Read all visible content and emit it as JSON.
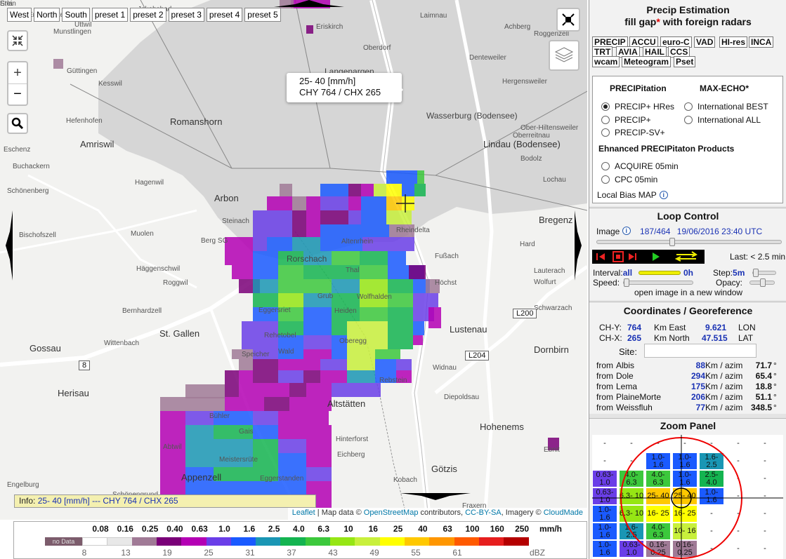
{
  "presets": [
    "West",
    "North",
    "South",
    "preset 1",
    "preset 2",
    "preset 3",
    "preset 4",
    "preset 5"
  ],
  "map": {
    "zoom_in": "+",
    "zoom_out": "−",
    "tooltip_line1": "25- 40 [mm/h]",
    "tooltip_line2": "CHY 764 / CHX 265",
    "info_label": "Info:",
    "info_value": "25- 40 [mm/h] --- CHY 764 / CHX 265",
    "attribution": {
      "leaflet": "Leaflet",
      "text1": " | Map data © ",
      "osm": "OpenStreetMap",
      "text2": " contributors, ",
      "license": "CC-BY-SA",
      "text3": ", Imagery © ",
      "cloudmade": "CloudMade"
    },
    "places": [
      {
        "name": "Romanshorn",
        "cls": "city"
      },
      {
        "name": "Amriswil",
        "cls": "city"
      },
      {
        "name": "Arbon",
        "cls": "city"
      },
      {
        "name": "St. Gallen",
        "cls": "city"
      },
      {
        "name": "Gossau",
        "cls": "city"
      },
      {
        "name": "Herisau",
        "cls": "city"
      },
      {
        "name": "Appenzell",
        "cls": "city"
      },
      {
        "name": "Altstätten",
        "cls": "city"
      },
      {
        "name": "Lustenau",
        "cls": "city"
      },
      {
        "name": "Dornbirn",
        "cls": "city"
      },
      {
        "name": "Hohenems",
        "cls": "city"
      },
      {
        "name": "Götzis",
        "cls": "city"
      },
      {
        "name": "Lindau (Bodensee)",
        "cls": "city"
      },
      {
        "name": "Bregenz",
        "cls": "city"
      },
      {
        "name": "Langenargen",
        "cls": "town"
      },
      {
        "name": "Wasserburg (Bodensee)",
        "cls": "town"
      },
      {
        "name": "Rorschach",
        "cls": "town"
      },
      {
        "name": "Berg SG",
        "cls": "place"
      },
      {
        "name": "Steinach",
        "cls": "place"
      },
      {
        "name": "Eriskirch",
        "cls": "place"
      },
      {
        "name": "Oberdorf",
        "cls": "place"
      },
      {
        "name": "Laimnau",
        "cls": "place"
      },
      {
        "name": "Achberg",
        "cls": "place"
      },
      {
        "name": "Roggenzell",
        "cls": "place"
      },
      {
        "name": "Denteweiler",
        "cls": "place"
      },
      {
        "name": "Hergensweiler",
        "cls": "place"
      },
      {
        "name": "Ober-Hiltensweiler",
        "cls": "place"
      },
      {
        "name": "Oberreitnau",
        "cls": "place"
      },
      {
        "name": "Bodolz",
        "cls": "place"
      },
      {
        "name": "Lochau",
        "cls": "place"
      },
      {
        "name": "Rheindelta",
        "cls": "place"
      },
      {
        "name": "Höchst",
        "cls": "place"
      },
      {
        "name": "Fußach",
        "cls": "place"
      },
      {
        "name": "Hard",
        "cls": "place"
      },
      {
        "name": "Lauterach",
        "cls": "place"
      },
      {
        "name": "Wolfurt",
        "cls": "place"
      },
      {
        "name": "Schwarzach",
        "cls": "place"
      },
      {
        "name": "Altenrhein",
        "cls": "place"
      },
      {
        "name": "Thal",
        "cls": "place"
      },
      {
        "name": "Heiden",
        "cls": "place"
      },
      {
        "name": "Grub",
        "cls": "place"
      },
      {
        "name": "Wolfhalden",
        "cls": "place"
      },
      {
        "name": "Rehetobel",
        "cls": "place"
      },
      {
        "name": "Eggersriet",
        "cls": "place"
      },
      {
        "name": "Wald",
        "cls": "place"
      },
      {
        "name": "Oberegg",
        "cls": "place"
      },
      {
        "name": "Rebstein",
        "cls": "place"
      },
      {
        "name": "Widnau",
        "cls": "place"
      },
      {
        "name": "Diepoldsau",
        "cls": "place"
      },
      {
        "name": "Kobach",
        "cls": "place"
      },
      {
        "name": "Hinterforst",
        "cls": "place"
      },
      {
        "name": "Eichberg",
        "cls": "place"
      },
      {
        "name": "Gais",
        "cls": "place"
      },
      {
        "name": "Bühler",
        "cls": "place"
      },
      {
        "name": "Meistersrüte",
        "cls": "place"
      },
      {
        "name": "Eggerstanden",
        "cls": "place"
      },
      {
        "name": "Fraxern",
        "cls": "place"
      },
      {
        "name": "Ebnit",
        "cls": "place"
      },
      {
        "name": "Speicher",
        "cls": "place"
      },
      {
        "name": "Bischofszell",
        "cls": "place"
      },
      {
        "name": "Güttingen",
        "cls": "place"
      },
      {
        "name": "Kesswil",
        "cls": "place"
      },
      {
        "name": "Hefenhofen",
        "cls": "place"
      },
      {
        "name": "Schönenberg",
        "cls": "place"
      },
      {
        "name": "Buchackern",
        "cls": "place"
      },
      {
        "name": "Hagenwil",
        "cls": "place"
      },
      {
        "name": "Muolen",
        "cls": "place"
      },
      {
        "name": "Häggenschwil",
        "cls": "place"
      },
      {
        "name": "Roggwil",
        "cls": "place"
      },
      {
        "name": "Bernhardzell",
        "cls": "place"
      },
      {
        "name": "Wittenbach",
        "cls": "place"
      },
      {
        "name": "Engelburg",
        "cls": "place"
      },
      {
        "name": "Abtwil",
        "cls": "place"
      },
      {
        "name": "Schönengrund",
        "cls": "place"
      },
      {
        "name": "Enggähutten",
        "cls": "place"
      },
      {
        "name": "Jakobsbad",
        "cls": "place"
      },
      {
        "name": "Munstlingen",
        "cls": "place"
      },
      {
        "name": "Uttwil",
        "cls": "place"
      },
      {
        "name": "Eschenz",
        "cls": "place"
      },
      {
        "name": "Stein",
        "cls": "place"
      },
      {
        "name": "Erla",
        "cls": "place"
      }
    ],
    "roads": [
      "L200",
      "L204",
      "8"
    ]
  },
  "legend": {
    "unit": "mm/h",
    "no_data": "no Data",
    "dbz_unit": "dBZ",
    "mmh": [
      "0.08",
      "0.16",
      "0.25",
      "0.40",
      "0.63",
      "1.0",
      "1.6",
      "2.5",
      "4.0",
      "6.3",
      "10",
      "16",
      "25",
      "40",
      "63",
      "100",
      "160",
      "250"
    ],
    "dbz": [
      "8",
      "13",
      "19",
      "25",
      "31",
      "37",
      "43",
      "49",
      "55",
      "61"
    ],
    "colors": [
      "#ffffff",
      "#e8e8e8",
      "#a07a96",
      "#7a0078",
      "#b400b4",
      "#6a3ee8",
      "#1a5aff",
      "#1a96b4",
      "#14b450",
      "#3cc83c",
      "#96e614",
      "#c8f03c",
      "#ffff00",
      "#ffc800",
      "#ff9600",
      "#ff5a00",
      "#e61e1e",
      "#b40000"
    ]
  },
  "panel": {
    "title_line1": "Precip Estimation",
    "title_line2_a": "fill gap",
    "title_star": "*",
    "title_line2_b": " with foreign radars",
    "product_buttons": [
      "PRECIP",
      "ACCU",
      "euro-C",
      "VAD",
      "HI-res",
      "INCA",
      "TRT",
      "AVIA",
      "HAIL",
      "CCS",
      "wcam",
      "Meteogram",
      "Pset"
    ],
    "precip_header": "PRECIPitation",
    "maxecho_header": "MAX-ECHO*",
    "precip_options": [
      "PRECIP+ HRes",
      "PRECIP+",
      "PRECIP-SV+"
    ],
    "maxecho_options": [
      "International BEST",
      "International ALL"
    ],
    "enhanced_header": "Ehnanced PRECIPitaton Products",
    "enhanced_options": [
      "ACQUIRE 05min",
      "CPC 05min"
    ],
    "local_bias": "Local Bias MAP",
    "info_glyph": "i",
    "loop": {
      "title": "Loop Control",
      "image_label": "Image",
      "image_index": "187/464",
      "image_datetime": "19/06/2016 23:40 UTC",
      "image_progress": 0.403,
      "last": "Last: < 2.5 min",
      "interval_label": "Interval:",
      "interval_start": "all",
      "interval_end": "0h",
      "step_label": "Step:",
      "step_value": "5m",
      "speed_label": "Speed:",
      "opacy_label": "Opacy:",
      "open_image": "open image in a new window"
    },
    "coords": {
      "title": "Coordinates / Georeference",
      "chy_label": "CH-Y:",
      "chy": "764",
      "km_east_label": "Km East",
      "lon": "9.621",
      "lon_label": "LON",
      "chx_label": "CH-X:",
      "chx": "265",
      "km_north_label": "Km North",
      "lat": "47.515",
      "lat_label": "LAT",
      "site_label": "Site:",
      "site_value": "",
      "radars": [
        {
          "from": "from ",
          "name": "Albis",
          "km": "88",
          "unit": " Km / azim",
          "az": "71.7",
          "deg": "°"
        },
        {
          "from": "from ",
          "name": "Dole",
          "km": "294",
          "unit": " Km / azim",
          "az": "65.4",
          "deg": "°"
        },
        {
          "from": "from ",
          "name": "Lema",
          "km": "175",
          "unit": " Km / azim",
          "az": "18.8",
          "deg": "°"
        },
        {
          "from": "from ",
          "name": "PlaineMorte",
          "km": "206",
          "unit": " Km / azim",
          "az": "51.1",
          "deg": "°"
        },
        {
          "from": "from ",
          "name": "Weissfluh",
          "km": "77",
          "unit": " Km / azim",
          "az": "348.5",
          "deg": "°"
        }
      ]
    },
    "zoom": {
      "title": "Zoom Panel",
      "grid": [
        [
          "-",
          "-",
          "-",
          "-",
          "-",
          "-",
          "-"
        ],
        [
          "-",
          "-",
          "1.0-\n1.6",
          "1.0-\n1.6",
          "1.6-\n2.5",
          "-",
          "-"
        ],
        [
          "0.63-\n1.0",
          "4.0-\n6.3",
          "4.0-\n6.3",
          "1.0-\n1.6",
          "2.5-\n4.0",
          "-",
          "-"
        ],
        [
          "0.63-\n1.0",
          "6.3- 10",
          "25- 40",
          "25- 40",
          "1.0-\n1.6",
          "-",
          "-"
        ],
        [
          "1.0-\n1.6",
          "6.3- 10",
          "16- 25",
          "16- 25",
          "-",
          "-",
          "-"
        ],
        [
          "1.0-\n1.6",
          "1.6-\n2.5",
          "4.0-\n6.3",
          "10- 16",
          "-",
          "-",
          "-"
        ],
        [
          "1.0-\n1.6",
          "0.63-\n1.0",
          "0.16-\n0.25",
          "0.16-\n0.25",
          "-",
          "-",
          "-"
        ]
      ],
      "grid_colors": [
        [
          "#fff",
          "#fff",
          "#fff",
          "#fff",
          "#fff",
          "#fff",
          "#fff"
        ],
        [
          "#fff",
          "#fff",
          "#1a5aff",
          "#1a5aff",
          "#1a96b4",
          "#fff",
          "#fff"
        ],
        [
          "#6a3ee8",
          "#3cc83c",
          "#3cc83c",
          "#1a5aff",
          "#14b450",
          "#fff",
          "#fff"
        ],
        [
          "#6a3ee8",
          "#96e614",
          "#ffc800",
          "#ffc800",
          "#1a5aff",
          "#fff",
          "#fff"
        ],
        [
          "#1a5aff",
          "#96e614",
          "#ffff00",
          "#ffff00",
          "#fff",
          "#fff",
          "#fff"
        ],
        [
          "#1a5aff",
          "#1a96b4",
          "#3cc83c",
          "#c8f03c",
          "#fff",
          "#fff",
          "#fff"
        ],
        [
          "#1a5aff",
          "#6a3ee8",
          "#a07a96",
          "#a07a96",
          "#fff",
          "#fff",
          "#fff"
        ]
      ]
    }
  }
}
